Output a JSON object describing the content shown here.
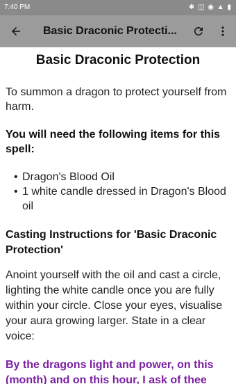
{
  "status_bar": {
    "time": "7:40 PM",
    "icons_text": "✱ ◫ ◉ ▲ ▮"
  },
  "app_bar": {
    "title": "Basic Draconic Protecti..."
  },
  "article": {
    "title": "Basic Draconic Protection",
    "intro": "To summon a dragon to protect yourself from harm.",
    "items_heading": "You will need the following items for this spell:",
    "items": [
      "Dragon's Blood Oil",
      "1 white candle dressed in Dragon's Blood oil"
    ],
    "casting_heading": "Casting Instructions for 'Basic Draconic Protection'",
    "instructions": "Anoint yourself with the oil and cast a circle, lighting the white candle once you are fully within your circle. Close your eyes, visualise your aura growing larger. State in a clear voice:",
    "chant": "By the dragons light and power, on this (month) and on this hour, I ask of thee"
  },
  "colors": {
    "status_bar": "#8a8a8a",
    "app_bar": "#9b9b9b",
    "chant": "#7b1fa2"
  },
  "icons": [
    "back-arrow-icon",
    "refresh-icon",
    "more-vert-icon"
  ]
}
